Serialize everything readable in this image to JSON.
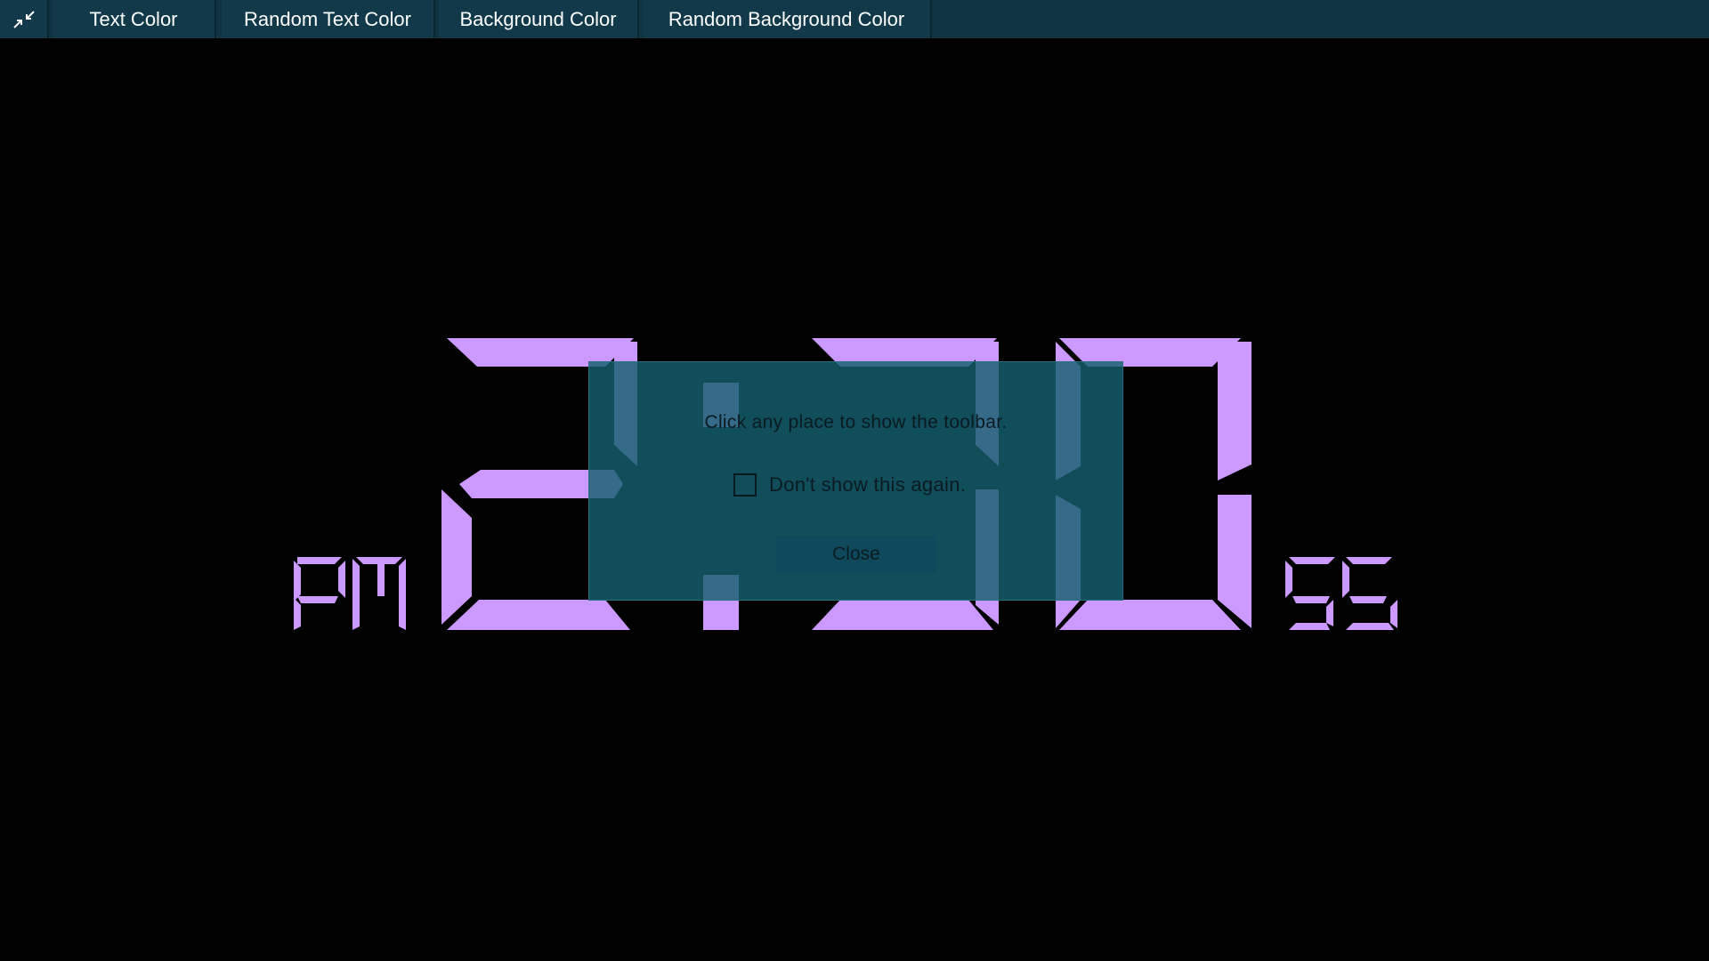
{
  "toolbar": {
    "exit_icon": "exit-fullscreen-icon",
    "text_color_label": "Text Color",
    "random_text_color_label": "Random Text Color",
    "background_color_label": "Background Color",
    "random_background_color_label": "Random Background Color"
  },
  "clock": {
    "period": "PM",
    "time": "2:30",
    "seconds": "55",
    "digit_color": "#cc99ff",
    "background_color": "#000000"
  },
  "dialog": {
    "message": "Click any place to show the toolbar.",
    "checkbox_label": "Don't show this again.",
    "checkbox_checked": false,
    "close_label": "Close"
  },
  "colors": {
    "toolbar_bg": "#0f3340",
    "dialog_bg": "#145f6e",
    "accent": "#cc99ff"
  }
}
